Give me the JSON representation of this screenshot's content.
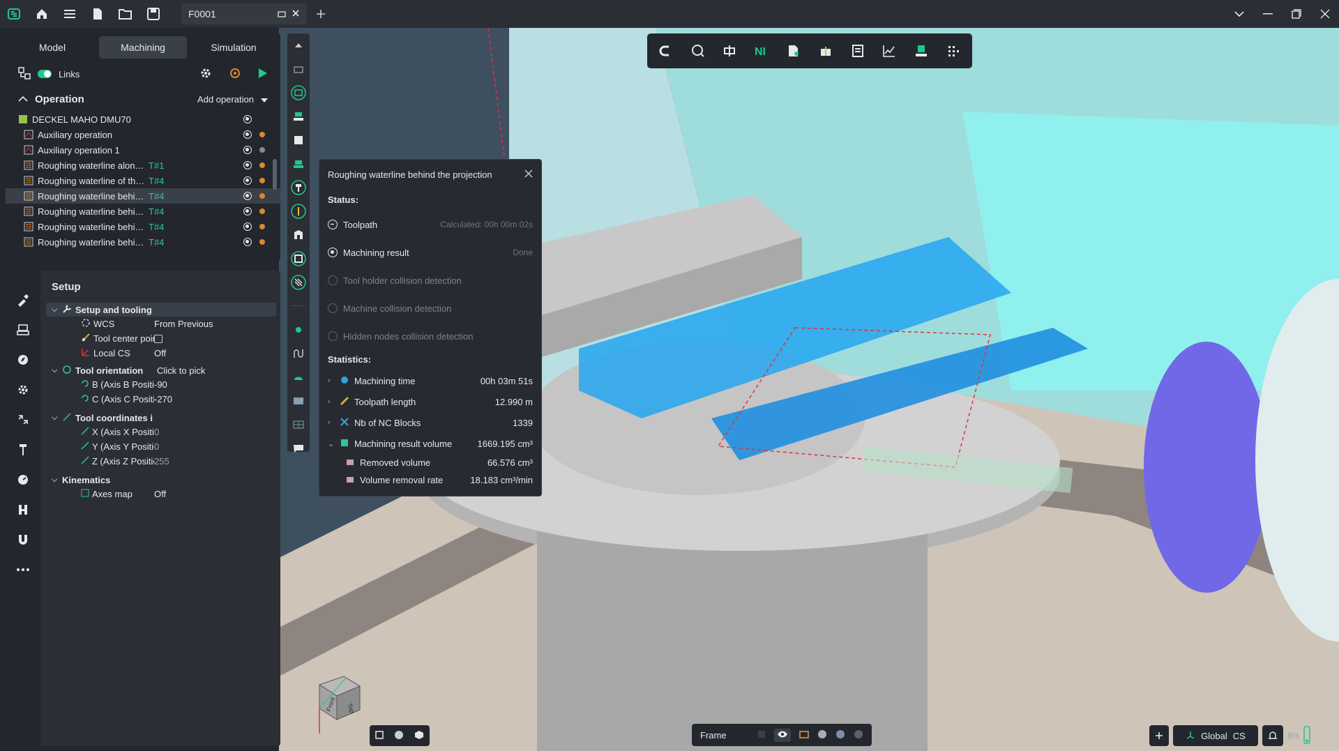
{
  "titlebar": {
    "file_name": "F0001"
  },
  "tabs": [
    {
      "label": "Model"
    },
    {
      "label": "Machining"
    },
    {
      "label": "Simulation"
    }
  ],
  "links": {
    "label": "Links"
  },
  "operation": {
    "title": "Operation",
    "add_label": "Add operation",
    "items": [
      {
        "label": "DECKEL MAHO DMU70",
        "tool": ""
      },
      {
        "label": "Auxiliary operation",
        "tool": ""
      },
      {
        "label": "Auxiliary operation 1",
        "tool": ""
      },
      {
        "label": "Roughing waterline alon…",
        "tool": "T#1"
      },
      {
        "label": "Roughing waterline of th…",
        "tool": "T#4"
      },
      {
        "label": "Roughing waterline behi…",
        "tool": "T#4"
      },
      {
        "label": "Roughing waterline behi…",
        "tool": "T#4"
      },
      {
        "label": "Roughing waterline behi…",
        "tool": "T#4"
      },
      {
        "label": "Roughing waterline behi…",
        "tool": "T#4"
      }
    ]
  },
  "setup": {
    "title": "Setup",
    "group_setup": "Setup and tooling",
    "wcs_label": "WCS",
    "wcs_value": "From Previous",
    "tcp_label": "Tool center point",
    "localcs_label": "Local CS",
    "localcs_value": "Off",
    "orient_label": "Tool orientation",
    "orient_value": "Click to pick",
    "b_label": "B (Axis B Positio",
    "b_value": "-90",
    "c_label": "C (Axis C Positio",
    "c_value": "-270",
    "coords_label": "Tool coordinates i",
    "x_label": "X (Axis X Positior",
    "x_value": "0",
    "y_label": "Y (Axis Y Positio",
    "y_value": "0",
    "z_label": "Z (Axis Z Positior",
    "z_value": "255",
    "kin_label": "Kinematics",
    "axes_label": "Axes map",
    "axes_value": "Off"
  },
  "popup": {
    "title": "Roughing waterline behind the projection",
    "status_label": "Status:",
    "status": [
      {
        "label": "Toolpath",
        "value": "Calculated: 00h 00m 02s"
      },
      {
        "label": "Machining result",
        "value": "Done"
      },
      {
        "label": "Tool holder collision detection",
        "value": ""
      },
      {
        "label": "Machine collision detection",
        "value": ""
      },
      {
        "label": "Hidden nodes collision detection",
        "value": ""
      }
    ],
    "stats_label": "Statistics:",
    "stats": [
      {
        "label": "Machining time",
        "value": "00h 03m 51s"
      },
      {
        "label": "Toolpath length",
        "value": "12.990 m"
      },
      {
        "label": "Nb of NC Blocks",
        "value": "1339"
      },
      {
        "label": "Machining result volume",
        "value": "1669.195 cm³"
      }
    ],
    "sub_stats": [
      {
        "label": "Removed volume",
        "value": "66.576 cm³"
      },
      {
        "label": "Volume removal rate",
        "value": "18.183 cm³/min"
      }
    ]
  },
  "viewport": {
    "frame_label": "Frame",
    "cs_label": "Global",
    "cs_suffix": "CS",
    "zoom": "8%",
    "cube_front": "Front",
    "cube_top": "Top"
  },
  "colors": {
    "accent": "#1ec98c",
    "tool_tag": "#2ec4a6",
    "status_orange": "#d98a2b",
    "toolpath": "#1e9bff"
  }
}
